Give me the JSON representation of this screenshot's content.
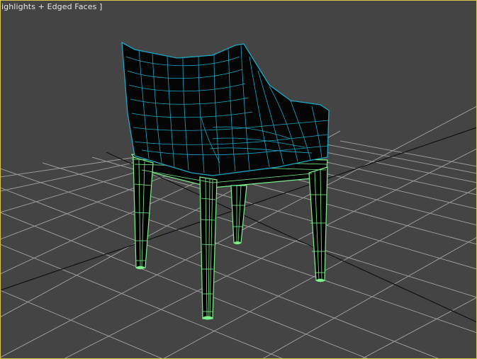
{
  "viewport": {
    "label": "ighlights + Edged Faces ]",
    "colors": {
      "background": "#444444",
      "grid": "#9a9a9a",
      "grid_axis": "#111111",
      "active_border": "#d7c84a",
      "shell_fill": "#050505",
      "shell_wire": "#1aa7c4",
      "legs_fill": "#050505",
      "legs_wire": "#7cf08a"
    }
  }
}
